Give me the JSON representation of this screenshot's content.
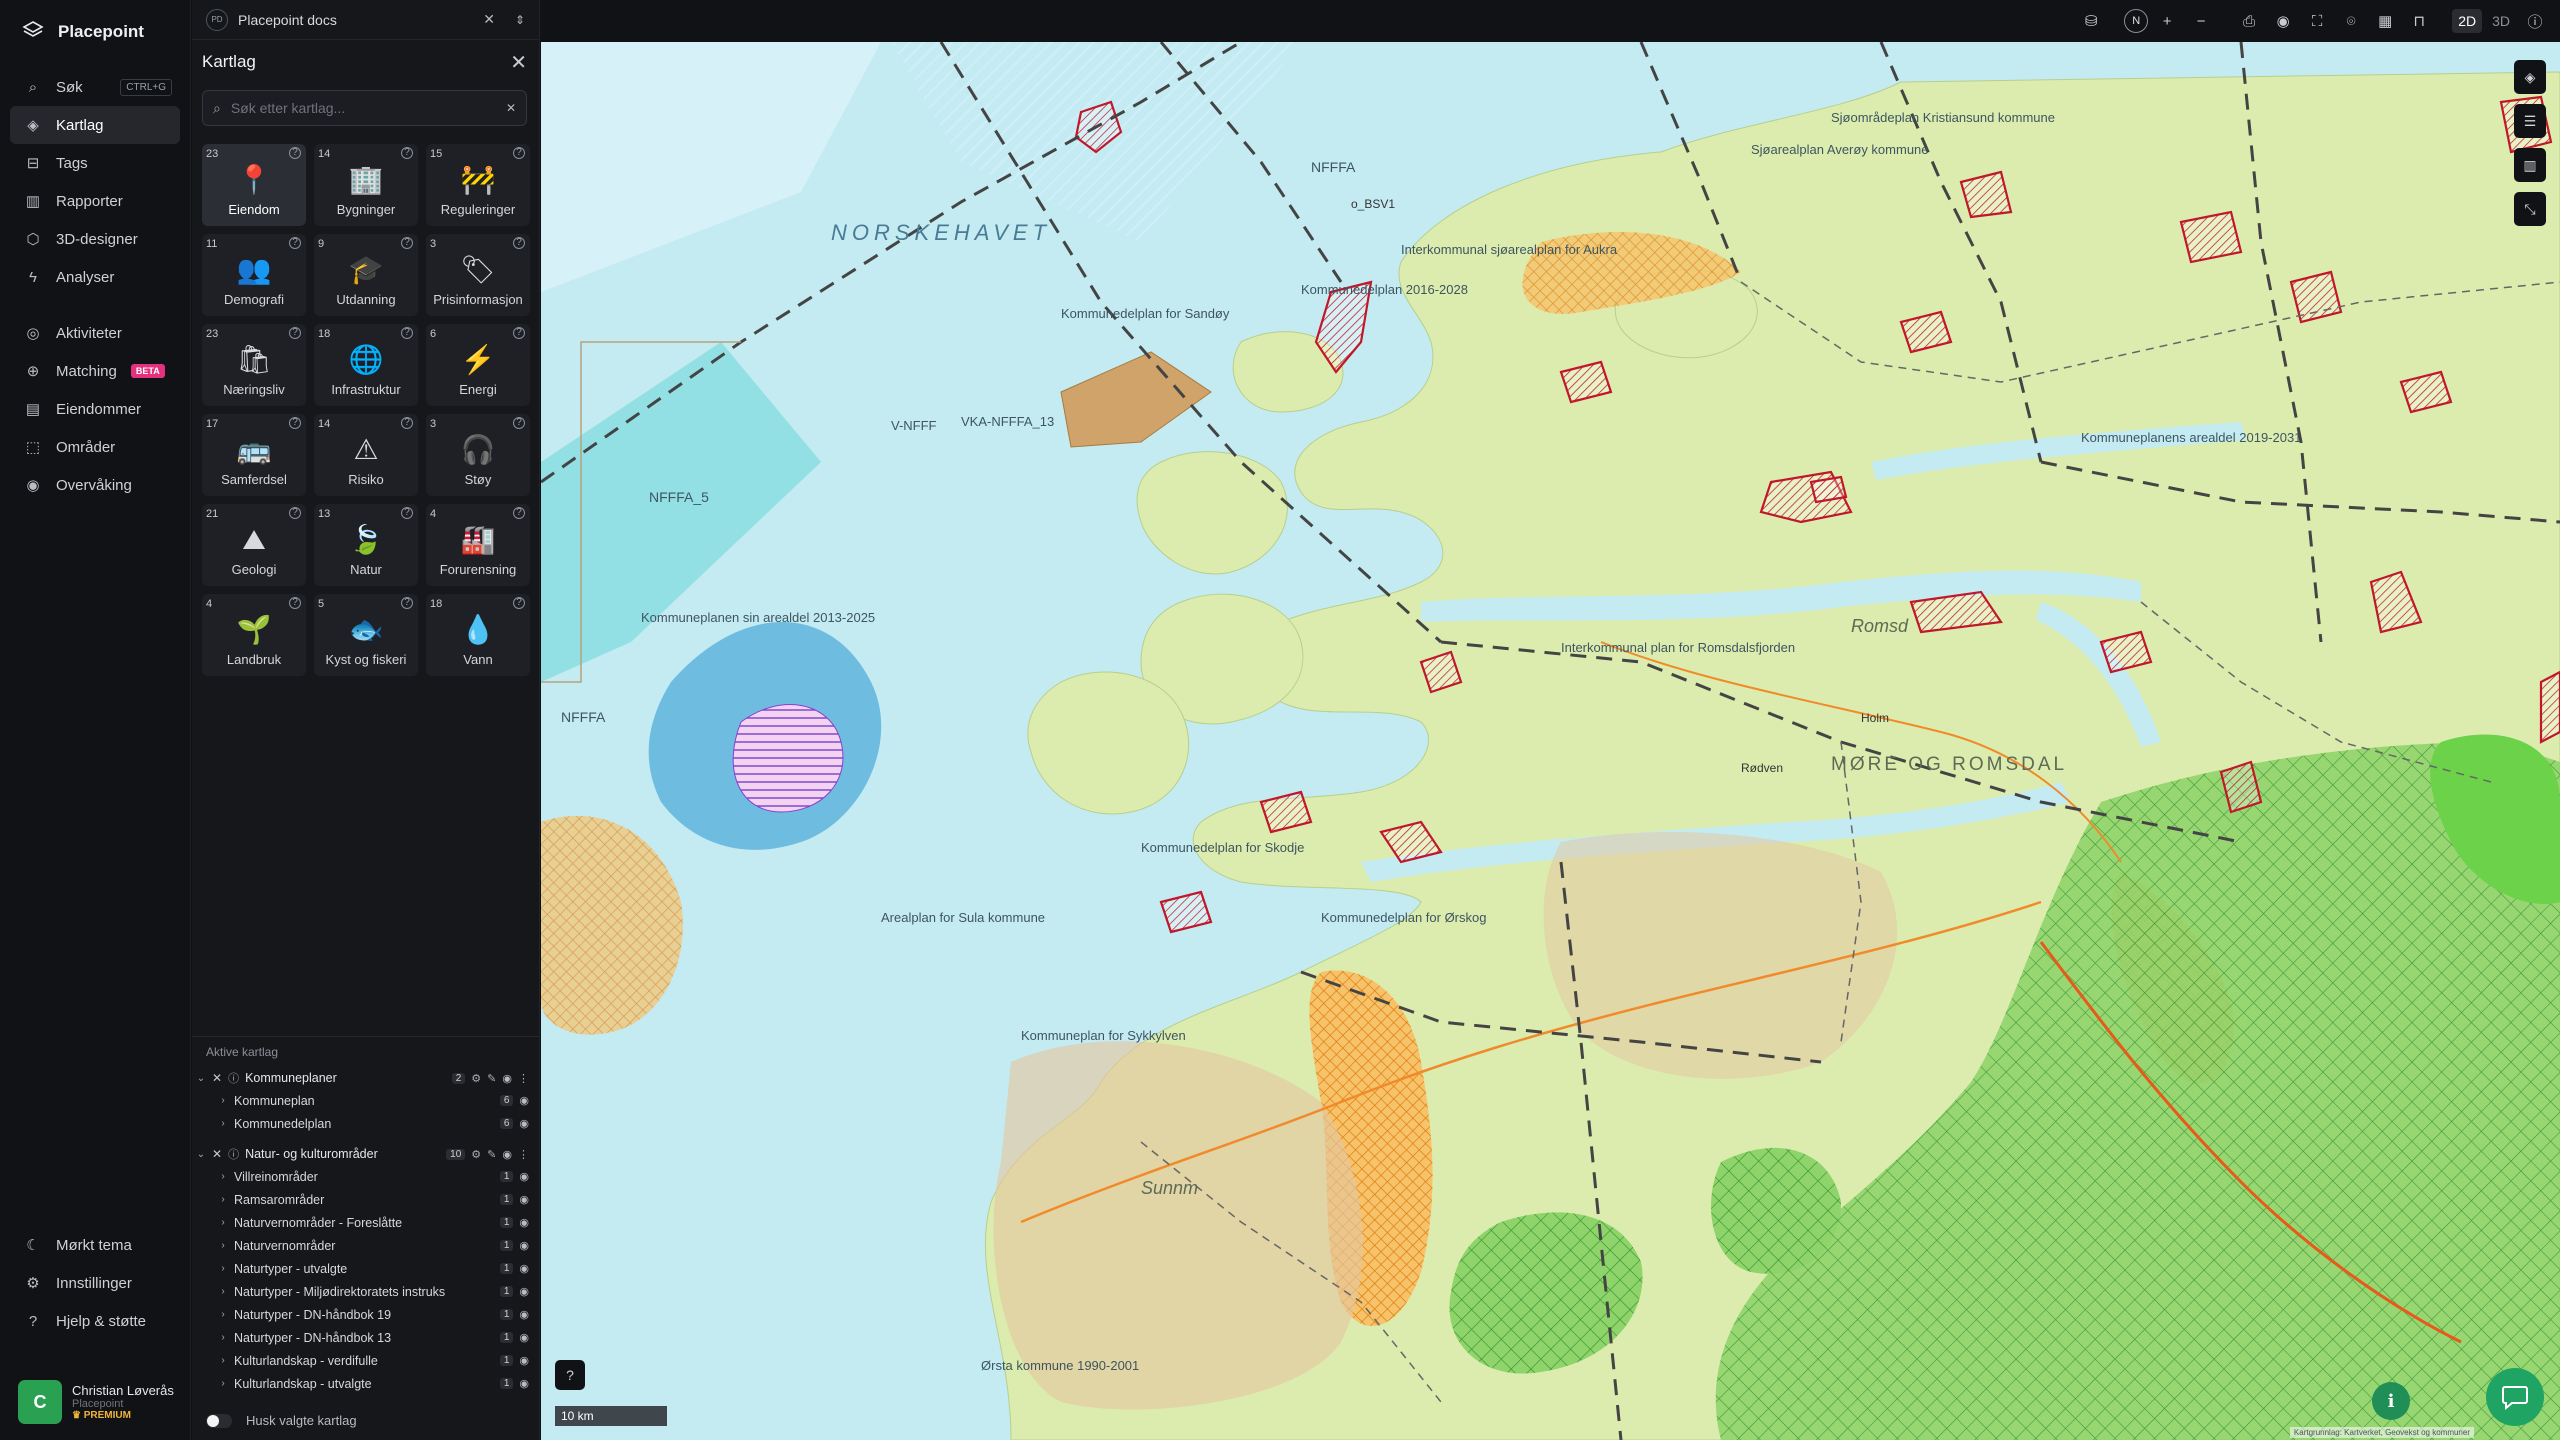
{
  "app": {
    "name": "Placepoint"
  },
  "nav": {
    "items": [
      {
        "label": "Søk",
        "kbd": "CTRL+G",
        "icon": "search-icon"
      },
      {
        "label": "Kartlag",
        "icon": "layers-icon"
      },
      {
        "label": "Tags",
        "icon": "bookmark-icon"
      },
      {
        "label": "Rapporter",
        "icon": "chart-icon"
      },
      {
        "label": "3D-designer",
        "icon": "cube-icon"
      },
      {
        "label": "Analyser",
        "icon": "bolt-icon"
      }
    ],
    "items2": [
      {
        "label": "Aktiviteter",
        "icon": "activity-icon"
      },
      {
        "label": "Matching",
        "badge": "BETA",
        "icon": "match-icon"
      },
      {
        "label": "Eiendommer",
        "icon": "property-icon"
      },
      {
        "label": "Områder",
        "icon": "area-icon"
      },
      {
        "label": "Overvåking",
        "icon": "monitor-icon"
      }
    ],
    "bottom": [
      {
        "label": "Mørkt tema",
        "icon": "moon-icon"
      },
      {
        "label": "Innstillinger",
        "icon": "gear-icon"
      },
      {
        "label": "Hjelp & støtte",
        "icon": "help-icon"
      }
    ]
  },
  "user": {
    "initial": "C",
    "name": "Christian Løverås",
    "org": "Placepoint",
    "plan": "PREMIUM"
  },
  "document": {
    "badge": "PD",
    "title": "Placepoint docs"
  },
  "panel": {
    "title": "Kartlag",
    "search_placeholder": "Søk etter kartlag...",
    "categories": [
      {
        "count": "23",
        "label": "Eiendom",
        "glyph": "📍"
      },
      {
        "count": "14",
        "label": "Bygninger",
        "glyph": "🏢"
      },
      {
        "count": "15",
        "label": "Reguleringer",
        "glyph": "🚧"
      },
      {
        "count": "11",
        "label": "Demografi",
        "glyph": "👥"
      },
      {
        "count": "9",
        "label": "Utdanning",
        "glyph": "🎓"
      },
      {
        "count": "3",
        "label": "Prisinformasjon",
        "glyph": "🏷"
      },
      {
        "count": "23",
        "label": "Næringsliv",
        "glyph": "🛍"
      },
      {
        "count": "18",
        "label": "Infrastruktur",
        "glyph": "🌐"
      },
      {
        "count": "6",
        "label": "Energi",
        "glyph": "⚡"
      },
      {
        "count": "17",
        "label": "Samferdsel",
        "glyph": "🚌"
      },
      {
        "count": "14",
        "label": "Risiko",
        "glyph": "⚠"
      },
      {
        "count": "3",
        "label": "Støy",
        "glyph": "🎧"
      },
      {
        "count": "21",
        "label": "Geologi",
        "glyph": "⛰"
      },
      {
        "count": "13",
        "label": "Natur",
        "glyph": "🍃"
      },
      {
        "count": "4",
        "label": "Forurensning",
        "glyph": "🏭"
      },
      {
        "count": "4",
        "label": "Landbruk",
        "glyph": "🌱"
      },
      {
        "count": "5",
        "label": "Kyst og fiskeri",
        "glyph": "🐟"
      },
      {
        "count": "18",
        "label": "Vann",
        "glyph": "💧"
      }
    ],
    "active_title": "Aktive kartlag",
    "groups": [
      {
        "name": "Kommuneplaner",
        "count": "2",
        "layers": [
          {
            "name": "Kommuneplan",
            "count": "6"
          },
          {
            "name": "Kommunedelplan",
            "count": "6"
          }
        ]
      },
      {
        "name": "Natur- og kulturområder",
        "count": "10",
        "layers": [
          {
            "name": "Villreinområder",
            "count": "1"
          },
          {
            "name": "Ramsarområder",
            "count": "1"
          },
          {
            "name": "Naturvernområder - Foreslåtte",
            "count": "1"
          },
          {
            "name": "Naturvernområder",
            "count": "1"
          },
          {
            "name": "Naturtyper - utvalgte",
            "count": "1"
          },
          {
            "name": "Naturtyper - Miljødirektoratets instruks",
            "count": "1"
          },
          {
            "name": "Naturtyper - DN-håndbok 19",
            "count": "1"
          },
          {
            "name": "Naturtyper - DN-håndbok 13",
            "count": "1"
          },
          {
            "name": "Kulturlandskap - verdifulle",
            "count": "1"
          },
          {
            "name": "Kulturlandskap - utvalgte",
            "count": "1"
          }
        ]
      }
    ],
    "remember_label": "Husk valgte kartlag"
  },
  "toolbar": {
    "compass": "N",
    "mode_2d": "2D",
    "mode_3d": "3D"
  },
  "map": {
    "scale": "10 km",
    "labels": {
      "sea": "NORSKEHAVET",
      "region": "MØRE OG ROMSDAL",
      "romsd": "Romsd",
      "sunnm": "Sunnm",
      "nfffa5": "NFFFA_5",
      "nfffa": "NFFFA",
      "nfffa_top": "NFFFA",
      "vnfff": "V-NFFF",
      "vkanfffa": "VKA-NFFFA_13",
      "kp_sandoy": "Kommunedelplan for Sandøy",
      "kp_aukra": "Interkommunal sjøarealplan for Aukra",
      "kp_2016": "Kommunedelplan 2016-2028",
      "kp_areal": "Kommuneplanen sin arealdel 2013-2025",
      "kp_sula": "Arealplan for Sula kommune",
      "kp_skodje": "Kommunedelplan for Skodje",
      "kp_sykkylven": "Kommuneplan for Sykkylven",
      "kp_orskog": "Kommunedelplan for Ørskog",
      "kp_romsdal": "Interkommunal plan for Romsdalsfjorden",
      "kp_averoy": "Sjøarealplan Averøy kommune",
      "kp_kr": "Sjøområdeplan Kristiansund kommune",
      "kp_areal2019": "Kommuneplanens arealdel 2019-2031",
      "kp_volda": "Ørsta kommune 1990-2001",
      "holm": "Holm",
      "rodven": "Rødven",
      "obsv": "o_BSV1"
    },
    "attribution": "Kartgrunnlag: Kartverket, Geovekst og kommuner"
  },
  "colors": {
    "sea": "#bfe8ef",
    "land": "#dcecae",
    "boundary": "#4a4a4a",
    "plan_red": "#c0182a",
    "nature_green": "#3aa53a",
    "orange": "#f09a2a",
    "water_blue": "#4aa8d8",
    "brand_green": "#1fa463"
  }
}
